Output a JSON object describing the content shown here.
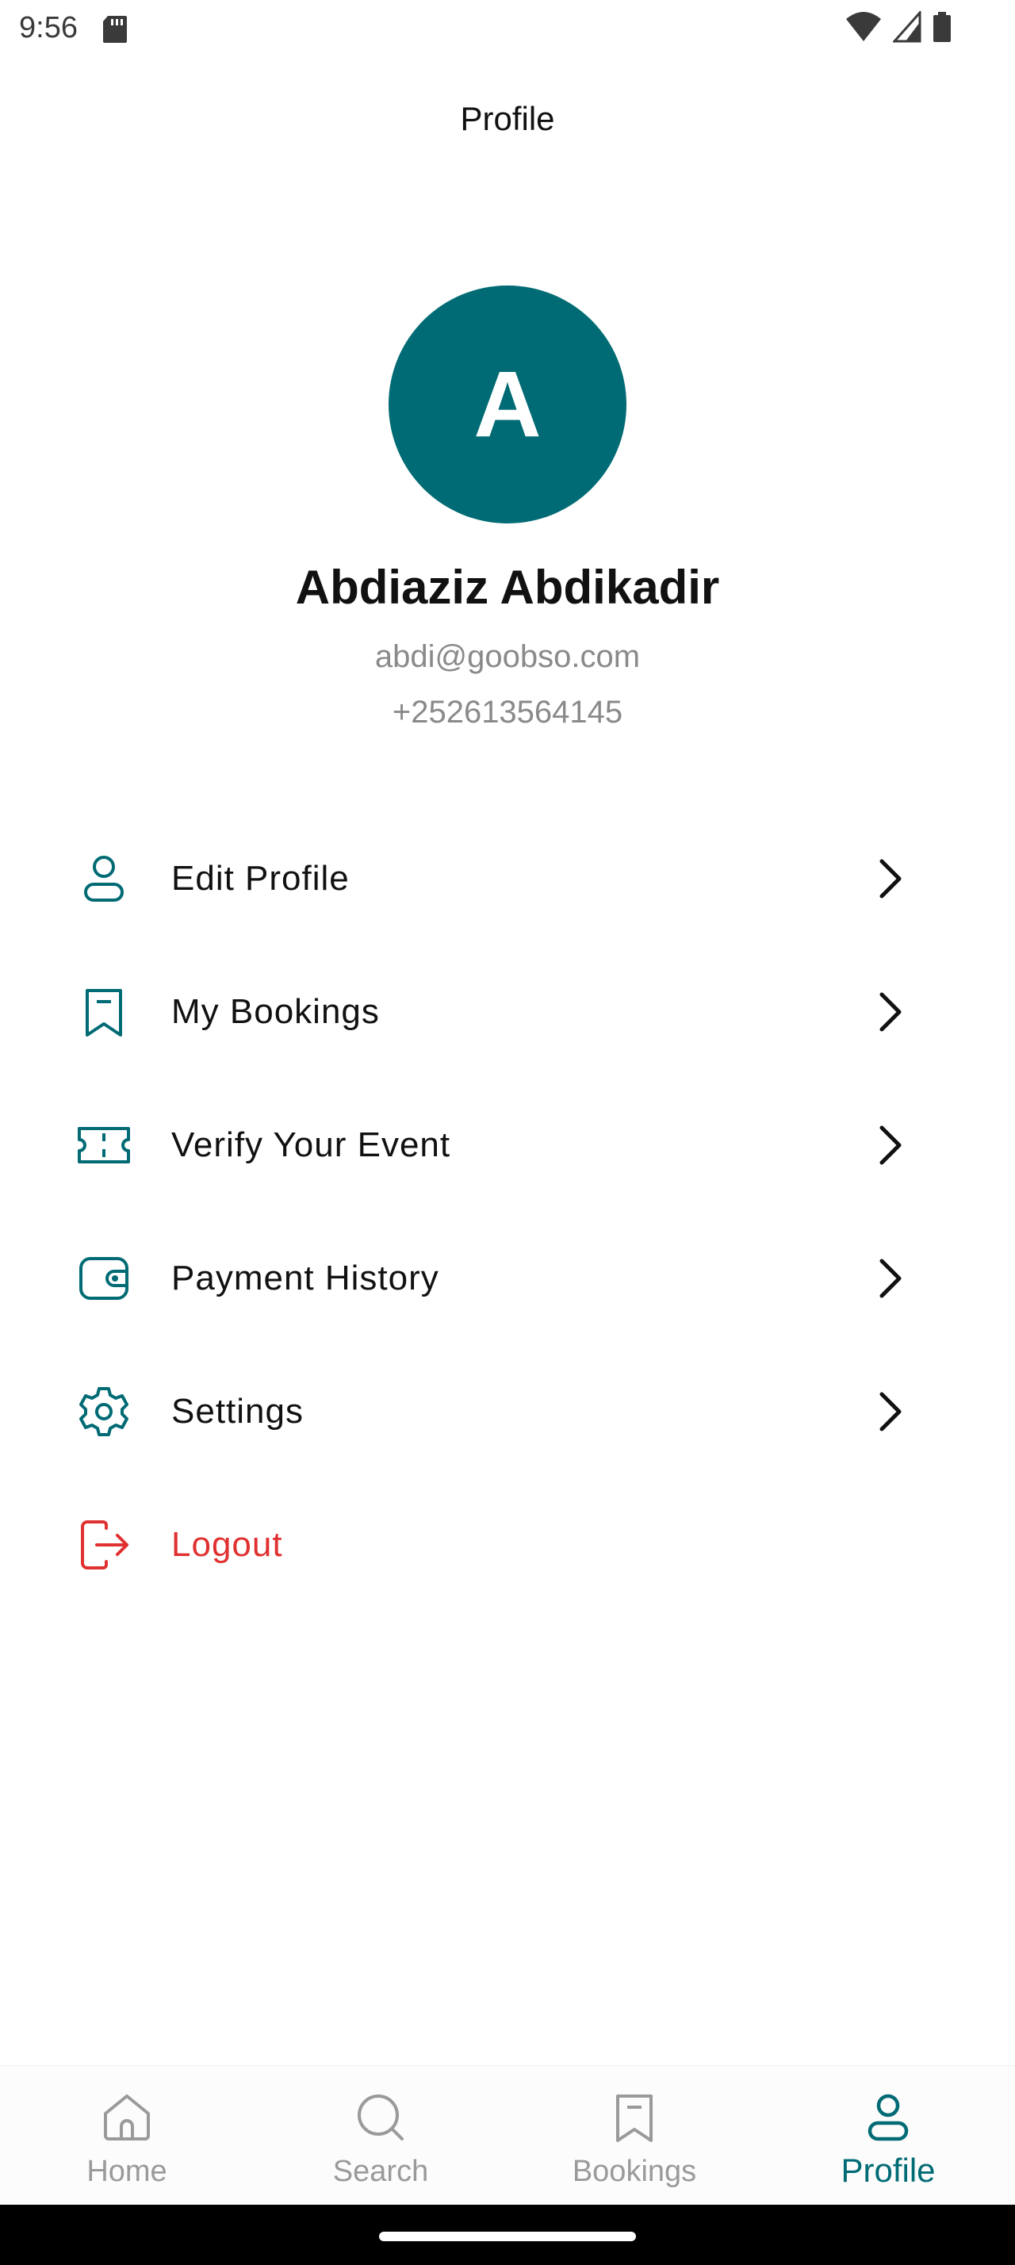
{
  "status": {
    "time": "9:56"
  },
  "header": {
    "title": "Profile"
  },
  "profile": {
    "initial": "A",
    "name": "Abdiaziz Abdikadir",
    "email": "abdi@goobso.com",
    "phone": "+252613564145",
    "avatar_color": "#006b74"
  },
  "menu": {
    "items": [
      {
        "label": "Edit Profile",
        "icon": "user-icon"
      },
      {
        "label": "My Bookings",
        "icon": "bookmark-icon"
      },
      {
        "label": "Verify Your Event",
        "icon": "ticket-icon"
      },
      {
        "label": "Payment History",
        "icon": "wallet-icon"
      },
      {
        "label": "Settings",
        "icon": "gear-icon"
      }
    ],
    "logout": {
      "label": "Logout",
      "icon": "logout-icon",
      "color": "#e03131"
    }
  },
  "bottom_nav": {
    "items": [
      {
        "label": "Home",
        "icon": "home-icon",
        "active": false
      },
      {
        "label": "Search",
        "icon": "search-icon",
        "active": false
      },
      {
        "label": "Bookings",
        "icon": "bookmark-icon",
        "active": false
      },
      {
        "label": "Profile",
        "icon": "user-icon",
        "active": true
      }
    ],
    "active_color": "#006b74",
    "inactive_color": "#9a9a9a"
  }
}
